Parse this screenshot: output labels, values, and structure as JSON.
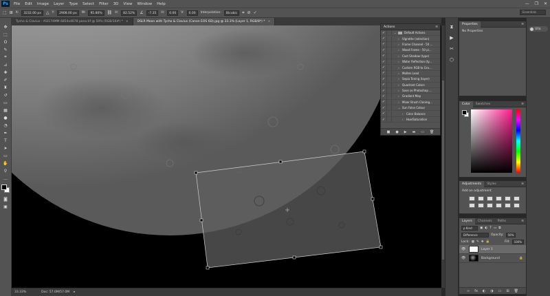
{
  "app": {
    "logo": "Ps"
  },
  "menu": [
    "File",
    "Edit",
    "Image",
    "Layer",
    "Type",
    "Select",
    "Filter",
    "3D",
    "View",
    "Window",
    "Help"
  ],
  "window_controls": [
    "—",
    "❐",
    "✕"
  ],
  "options": {
    "x_label": "X:",
    "x_value": "3232.00 px",
    "y_label": "Y:",
    "y_value": "2908.00 px",
    "w_label": "W:",
    "w_value": "95.80%",
    "h_label": "H:",
    "h_value": "82.52%",
    "angle_value": "-7.35",
    "hskew_label": "H:",
    "hskew_value": "0.00",
    "vskew_label": "V:",
    "vskew_value": "0.00",
    "interp_label": "Interpolation:",
    "interp_value": "Bicubic",
    "workspace": "Essentials"
  },
  "tabs": [
    {
      "label": "Tycho & Clavius - ASI174MM 6854x4678 pano.tif @ 50% (RGB/16#) *",
      "active": false,
      "close": "×"
    },
    {
      "label": "DSLR Moon with Tycho & Clavius (Canon EOS 6D).jpg @ 33.3% (Layer 1, RGB/8*) *",
      "active": true,
      "close": "×"
    }
  ],
  "status": {
    "zoom": "33.33%",
    "doc": "Doc: 57.0M/57.0M",
    "arrow": "▸"
  },
  "actions_panel": {
    "title": "Actions",
    "menu": "≡",
    "set_name": "Default Actions",
    "items": [
      "Vignette (selection)",
      "Frame Channel - 50 ...",
      "Wood Frame - 50 pi...",
      "Cast Shadow (type)",
      "Water Reflection (ty...",
      "Custom RGB to Gra...",
      "Molten Lead",
      "Sepia Toning (layer)",
      "Quadrant Colors",
      "Save as Photoshop ...",
      "Gradient Map",
      "Mixer Brush Cloning...",
      "Sun False Colour",
      "Color Balance",
      "Hue/Saturation"
    ],
    "footer_icons": [
      "■",
      "●",
      "▶",
      "▬",
      "▭",
      "🗑"
    ]
  },
  "properties": {
    "tab": "Properties",
    "menu": "≡",
    "text": "No Properties"
  },
  "color": {
    "tab_color": "Color",
    "tab_swatches": "Swatches",
    "menu": "≡"
  },
  "adjustments": {
    "tab_adjustments": "Adjustments",
    "tab_styles": "Styles",
    "menu": "≡",
    "add_label": "Add an adjustment"
  },
  "layers": {
    "tab_layers": "Layers",
    "tab_channels": "Channels",
    "tab_paths": "Paths",
    "menu": "≡",
    "kind_label": "ρ Kind",
    "blend_mode": "Difference",
    "opacity_label": "Opacity:",
    "opacity_value": "50%",
    "lock_label": "Lock:",
    "fill_label": "Fill:",
    "fill_value": "100%",
    "items": [
      {
        "name": "Layer 1",
        "selected": true
      },
      {
        "name": "Background",
        "selected": false,
        "lock": "🔒"
      }
    ],
    "footer_icons": [
      "∞",
      "fx",
      "◐",
      "◑",
      "▭",
      "⊞",
      "🗑"
    ]
  },
  "user": {
    "label": "Ulla"
  }
}
